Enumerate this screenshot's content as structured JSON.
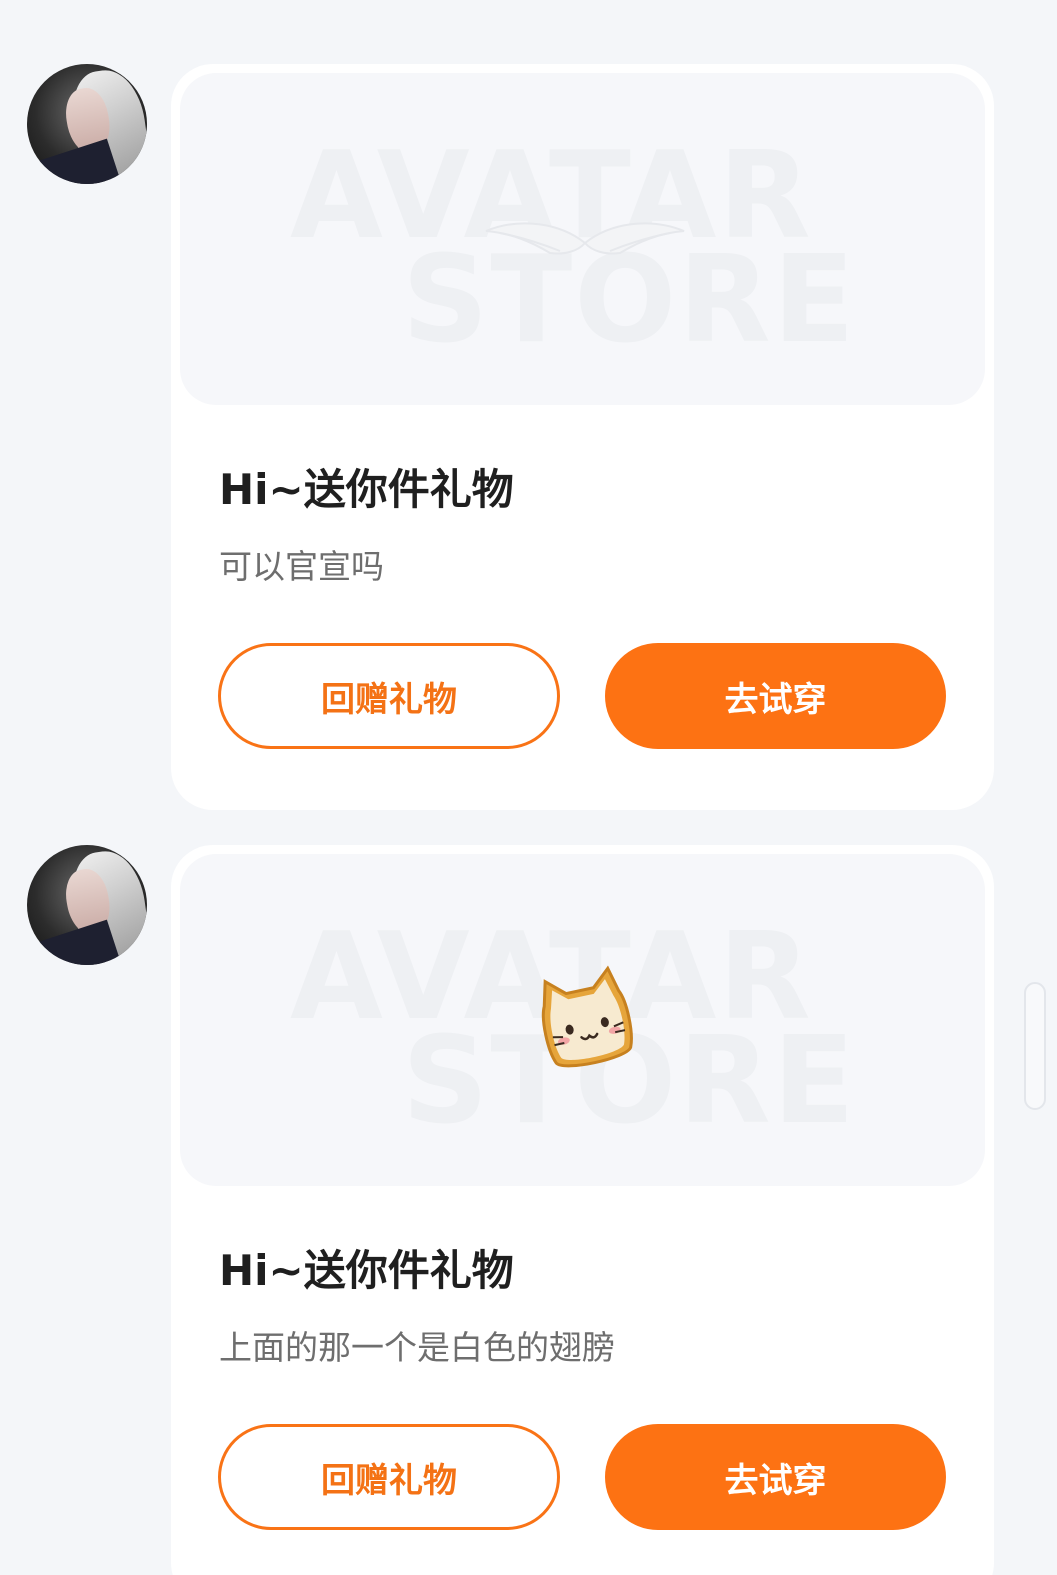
{
  "watermark": {
    "line1": "AVATAR",
    "line2": "STORE"
  },
  "messages": [
    {
      "avatar_icon": "user-avatar-icon",
      "gift_icon": "white-wings-icon",
      "title": "Hi~送你件礼物",
      "note": "可以官宣吗",
      "return_gift_label": "回赠礼物",
      "try_on_label": "去试穿"
    },
    {
      "avatar_icon": "user-avatar-icon",
      "gift_icon": "cat-bread-icon",
      "title": "Hi~送你件礼物",
      "note": "上面的那一个是白色的翅膀",
      "return_gift_label": "回赠礼物",
      "try_on_label": "去试穿"
    }
  ],
  "colors": {
    "accent": "#fd7213",
    "background": "#f4f6f9",
    "card": "#ffffff"
  }
}
